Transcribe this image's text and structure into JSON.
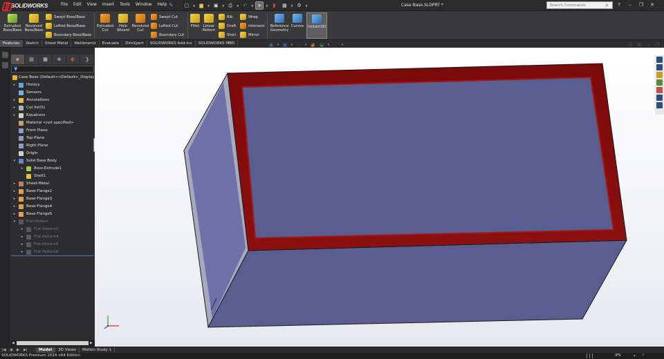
{
  "app": {
    "logo_prefix": "3S",
    "logo_text": "SOLIDWORKS",
    "document_title": "Case Base.SLDPRT *"
  },
  "menu": [
    "File",
    "Edit",
    "View",
    "Insert",
    "Tools",
    "Window",
    "Help"
  ],
  "search": {
    "placeholder": "Search Commands"
  },
  "command_manager": {
    "features": {
      "extruded_boss": "Extruded Boss/Base",
      "revolved_boss": "Revolved Boss/Base",
      "swept_boss": "Swept Boss/Base",
      "lofted_boss": "Lofted Boss/Base",
      "boundary_boss": "Boundary Boss/Base",
      "extruded_cut": "Extruded Cut",
      "hole_wizard": "Hole Wizard",
      "revolved_cut": "Revolved Cut",
      "swept_cut": "Swept Cut",
      "lofted_cut": "Lofted Cut",
      "boundary_cut": "Boundary Cut",
      "fillet": "Fillet",
      "linear_pattern": "Linear Pattern",
      "rib": "Rib",
      "draft": "Draft",
      "shell": "Shell",
      "wrap": "Wrap",
      "intersect": "Intersect",
      "mirror": "Mirror",
      "reference_geometry": "Reference Geometry",
      "curves": "Curves",
      "instant3d": "Instant3D"
    },
    "tabs": [
      {
        "label": "Features",
        "active": true
      },
      {
        "label": "Sketch"
      },
      {
        "label": "Sheet Metal"
      },
      {
        "label": "Weldments"
      },
      {
        "label": "Evaluate"
      },
      {
        "label": "DimXpert"
      },
      {
        "label": "SOLIDWORKS Add-Ins"
      },
      {
        "label": "SOLIDWORKS MBD"
      }
    ]
  },
  "feature_tree": {
    "root": "Case Base  (Default<<Default>_Display S",
    "items": [
      {
        "label": "History",
        "icon": "history-icon",
        "expandable": true
      },
      {
        "label": "Sensors",
        "icon": "sensor-icon"
      },
      {
        "label": "Annotations",
        "icon": "annotation-icon",
        "expandable": true
      },
      {
        "label": "Cut list(5)",
        "icon": "cutlist-icon",
        "expandable": true
      },
      {
        "label": "Equations",
        "icon": "equation-icon",
        "expandable": true
      },
      {
        "label": "Material <not specified>",
        "icon": "material-icon"
      },
      {
        "label": "Front Plane",
        "icon": "plane-icon"
      },
      {
        "label": "Top Plane",
        "icon": "plane-icon"
      },
      {
        "label": "Right Plane",
        "icon": "plane-icon"
      },
      {
        "label": "Origin",
        "icon": "origin-icon"
      },
      {
        "label": "Solid Base Body",
        "icon": "body-icon",
        "expanded": true
      },
      {
        "label": "Boss-Extrude1",
        "icon": "extrude-icon",
        "indent": 1,
        "expandable": true
      },
      {
        "label": "Shell1",
        "icon": "shell-icon",
        "indent": 1
      },
      {
        "label": "Sheet-Metal",
        "icon": "sheetmetal-icon",
        "expandable": true
      },
      {
        "label": "Base-Flange2",
        "icon": "flange-icon",
        "expandable": true
      },
      {
        "label": "Base-Flange3",
        "icon": "flange-icon",
        "expandable": true
      },
      {
        "label": "Base-Flange4",
        "icon": "flange-icon",
        "expandable": true
      },
      {
        "label": "Base-Flange5",
        "icon": "flange-icon",
        "expandable": true
      },
      {
        "label": "Flat-Pattern",
        "icon": "flatpattern-icon",
        "expanded": true,
        "dim": true
      },
      {
        "label": "Flat-Pattern2",
        "icon": "flatpattern-icon",
        "indent": 1,
        "expandable": true,
        "dim": true
      },
      {
        "label": "Flat-Pattern4",
        "icon": "flatpattern-icon",
        "indent": 1,
        "expandable": true,
        "dim": true
      },
      {
        "label": "Flat-Pattern5",
        "icon": "flatpattern-icon",
        "indent": 1,
        "expandable": true,
        "dim": true
      },
      {
        "label": "Flat-Pattern6",
        "icon": "flatpattern-icon",
        "indent": 1,
        "expandable": true,
        "dim": true
      }
    ]
  },
  "bottom_tabs": [
    {
      "label": "Model",
      "active": true
    },
    {
      "label": "3D Views"
    },
    {
      "label": "Motion Study 1"
    }
  ],
  "status": {
    "text": "SOLIDWORKS Premium 2016 x64 Edition",
    "units": "IPS"
  },
  "colors": {
    "model_face": "#5a5d8f",
    "model_rim": "#7a0a0a",
    "model_side": "#6e71a8"
  }
}
